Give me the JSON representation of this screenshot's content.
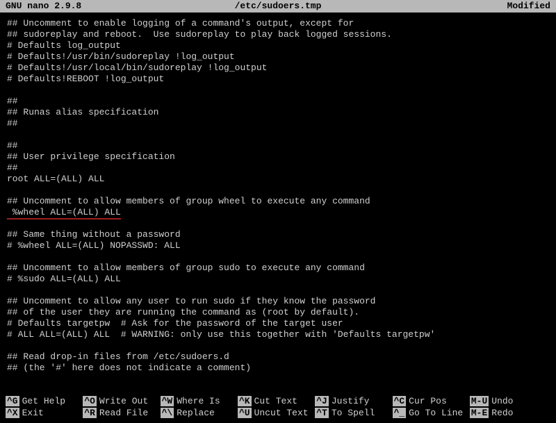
{
  "titlebar": {
    "app": "GNU nano 2.9.8",
    "file": "/etc/sudoers.tmp",
    "status": "Modified"
  },
  "lines": [
    "## Uncomment to enable logging of a command's output, except for",
    "## sudoreplay and reboot.  Use sudoreplay to play back logged sessions.",
    "# Defaults log_output",
    "# Defaults!/usr/bin/sudoreplay !log_output",
    "# Defaults!/usr/local/bin/sudoreplay !log_output",
    "# Defaults!REBOOT !log_output",
    "",
    "##",
    "## Runas alias specification",
    "##",
    "",
    "##",
    "## User privilege specification",
    "##",
    "root ALL=(ALL) ALL",
    "",
    "## Uncomment to allow members of group wheel to execute any command",
    " %wheel ALL=(ALL) ALL",
    "",
    "## Same thing without a password",
    "# %wheel ALL=(ALL) NOPASSWD: ALL",
    "",
    "## Uncomment to allow members of group sudo to execute any command",
    "# %sudo ALL=(ALL) ALL",
    "",
    "## Uncomment to allow any user to run sudo if they know the password",
    "## of the user they are running the command as (root by default).",
    "# Defaults targetpw  # Ask for the password of the target user",
    "# ALL ALL=(ALL) ALL  # WARNING: only use this together with 'Defaults targetpw'",
    "",
    "## Read drop-in files from /etc/sudoers.d",
    "## (the '#' here does not indicate a comment)"
  ],
  "underline_line_index": 17,
  "shortcuts": {
    "row1": [
      {
        "key": "^G",
        "label": "Get Help"
      },
      {
        "key": "^O",
        "label": "Write Out"
      },
      {
        "key": "^W",
        "label": "Where Is"
      },
      {
        "key": "^K",
        "label": "Cut Text"
      },
      {
        "key": "^J",
        "label": "Justify"
      },
      {
        "key": "^C",
        "label": "Cur Pos"
      },
      {
        "key": "M-U",
        "label": "Undo"
      }
    ],
    "row2": [
      {
        "key": "^X",
        "label": "Exit"
      },
      {
        "key": "^R",
        "label": "Read File"
      },
      {
        "key": "^\\",
        "label": "Replace"
      },
      {
        "key": "^U",
        "label": "Uncut Text"
      },
      {
        "key": "^T",
        "label": "To Spell"
      },
      {
        "key": "^_",
        "label": "Go To Line"
      },
      {
        "key": "M-E",
        "label": "Redo"
      }
    ]
  }
}
